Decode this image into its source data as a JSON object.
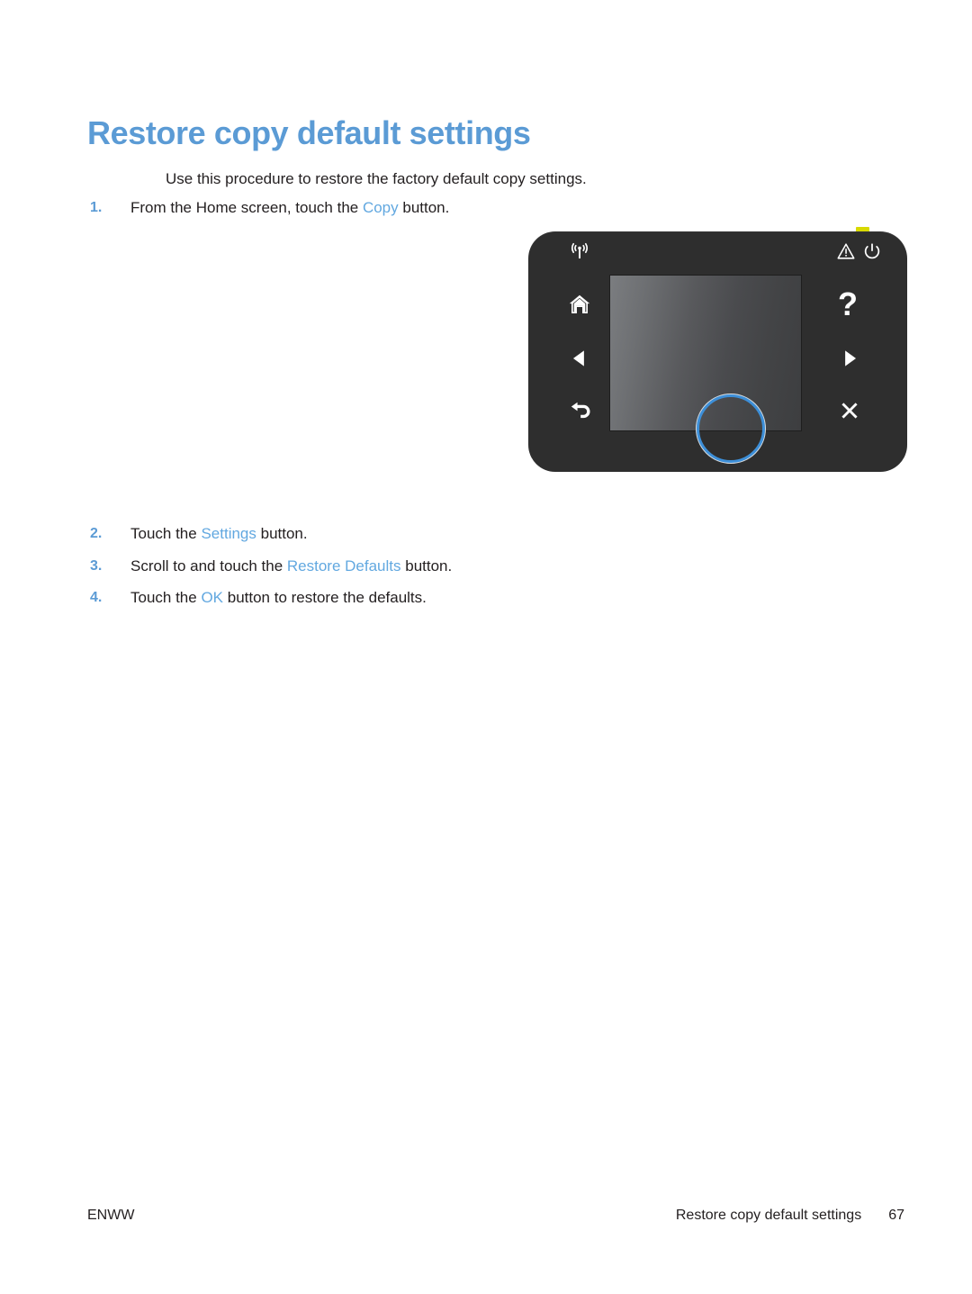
{
  "document": {
    "heading": "Restore copy default settings",
    "intro": "Use this procedure to restore the factory default copy settings."
  },
  "steps_before_figure": [
    {
      "number": "1.",
      "text_before": "From the Home screen, touch the ",
      "ui_term": "Copy",
      "text_after": " button."
    }
  ],
  "steps_after_figure": [
    {
      "number": "2.",
      "text_before": "Touch the ",
      "ui_term": "Settings",
      "text_after": " button."
    },
    {
      "number": "3.",
      "text_before": "Scroll to and touch the ",
      "ui_term": "Restore Defaults",
      "text_after": " button."
    },
    {
      "number": "4.",
      "text_before": "Touch the ",
      "ui_term": "OK",
      "text_after": " button to restore the defaults."
    }
  ],
  "figure": {
    "caption": "",
    "alt": "Printer control panel with touchscreen",
    "icons": {
      "wireless": "wireless-icon",
      "warning": "warning-icon",
      "power": "power-icon",
      "home": "home-icon",
      "left_arrow": "left-arrow-icon",
      "back": "back-arrow-icon",
      "help": "?",
      "right_arrow": "right-arrow-icon",
      "cancel": "close-x-icon"
    },
    "highlight": "copy-button-highlight"
  },
  "footer": {
    "left": "ENWW",
    "section_title": "Restore copy default settings",
    "page_number": "67"
  },
  "colors": {
    "heading_blue": "#5b9bd5",
    "ui_term_blue": "#62a8e0",
    "body_text": "#231f20",
    "panel_black": "#2e2e2e",
    "highlight_ring_blue": "#3d8fd8",
    "status_tab_yellow": "#d8d900"
  }
}
